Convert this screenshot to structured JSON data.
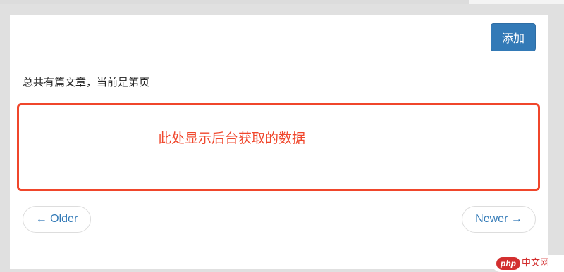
{
  "toolbar": {
    "add_label": "添加"
  },
  "summary": {
    "text": "总共有篇文章，当前是第页"
  },
  "content_area": {
    "placeholder_text": "此处显示后台获取的数据"
  },
  "pager": {
    "older_label": "← Older",
    "newer_label": "Newer →"
  },
  "watermark": {
    "brand_php": "php",
    "brand_cn": "中文网"
  },
  "colors": {
    "primary": "#337ab7",
    "highlight": "#f0462b",
    "watermark_red": "#d32f2f"
  }
}
